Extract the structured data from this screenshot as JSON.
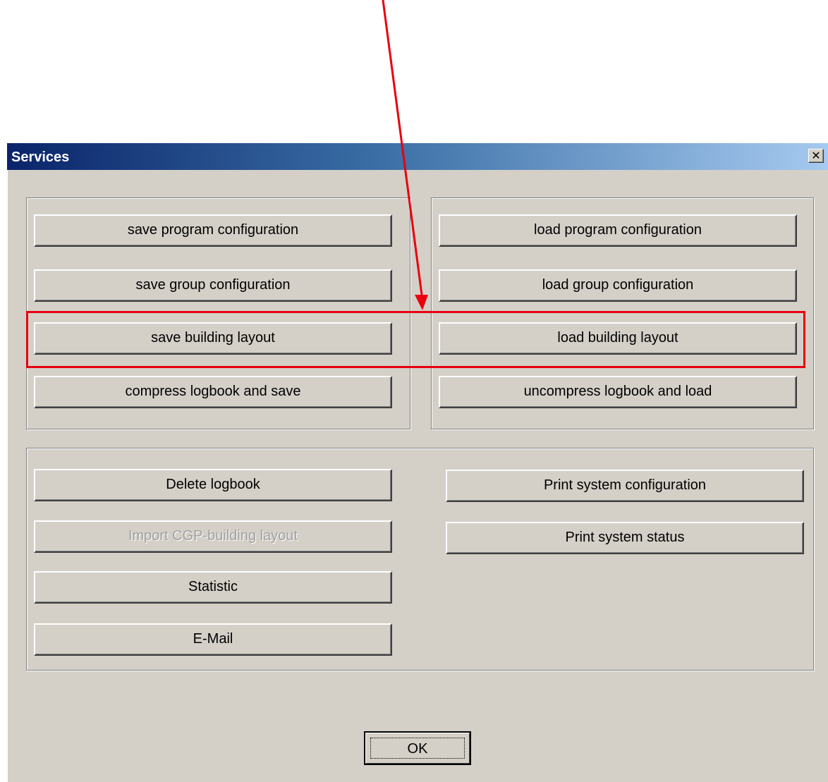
{
  "window": {
    "title": "Services",
    "close_glyph": "✕"
  },
  "save_group": {
    "buttons": [
      "save program configuration",
      "save group configuration",
      "save building layout",
      "compress logbook and save"
    ]
  },
  "load_group": {
    "buttons": [
      "load program configuration",
      "load group configuration",
      "load building layout",
      "uncompress logbook and load"
    ]
  },
  "tools_group": {
    "left_buttons": [
      {
        "label": "Delete logbook",
        "enabled": true
      },
      {
        "label": "Import CGP-building layout",
        "enabled": false
      },
      {
        "label": "Statistic",
        "enabled": true
      },
      {
        "label": "E-Mail",
        "enabled": true
      }
    ],
    "right_buttons": [
      {
        "label": "Print system configuration",
        "enabled": true
      },
      {
        "label": "Print system status",
        "enabled": true
      }
    ]
  },
  "ok_label": "OK",
  "annotation": {
    "color": "#e8000f"
  }
}
